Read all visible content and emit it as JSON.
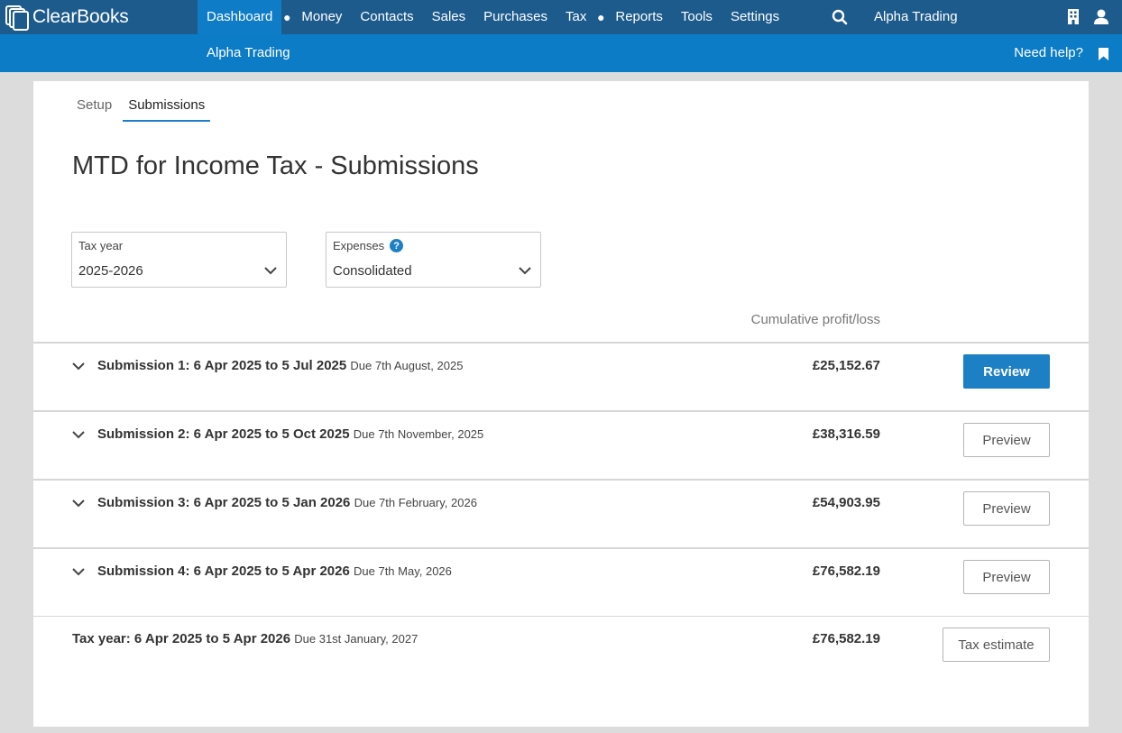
{
  "app": {
    "logo_text": "ClearBooks"
  },
  "nav": {
    "items": [
      {
        "label": "Dashboard",
        "active": true,
        "dot_after": true
      },
      {
        "label": "Money"
      },
      {
        "label": "Contacts"
      },
      {
        "label": "Sales"
      },
      {
        "label": "Purchases"
      },
      {
        "label": "Tax",
        "dot_after": true
      },
      {
        "label": "Reports"
      },
      {
        "label": "Tools"
      },
      {
        "label": "Settings"
      }
    ],
    "org_name": "Alpha Trading"
  },
  "subbar": {
    "title": "Alpha Trading",
    "help_label": "Need help?"
  },
  "tabs": [
    {
      "label": "Setup"
    },
    {
      "label": "Submissions",
      "active": true
    }
  ],
  "page": {
    "title": "MTD for Income Tax - Submissions"
  },
  "filters": {
    "tax_year": {
      "label": "Tax year",
      "value": "2025-2026"
    },
    "expenses": {
      "label": "Expenses",
      "value": "Consolidated",
      "help": "?"
    }
  },
  "table": {
    "column_header": "Cumulative profit/loss",
    "rows": [
      {
        "title": "Submission 1: 6 Apr 2025 to 5 Jul 2025",
        "due": "Due 7th August, 2025",
        "amount": "£25,152.67",
        "action": "Review"
      },
      {
        "title": "Submission 2: 6 Apr 2025 to 5 Oct 2025",
        "due": "Due 7th November, 2025",
        "amount": "£38,316.59",
        "action": "Preview"
      },
      {
        "title": "Submission 3: 6 Apr 2025 to 5 Jan 2026",
        "due": "Due 7th February, 2026",
        "amount": "£54,903.95",
        "action": "Preview"
      },
      {
        "title": "Submission 4: 6 Apr 2025 to 5 Apr 2026",
        "due": "Due 7th May, 2026",
        "amount": "£76,582.19",
        "action": "Preview"
      }
    ],
    "total": {
      "title": "Tax year: 6 Apr 2025 to 5 Apr 2026",
      "due": "Due 31st January, 2027",
      "amount": "£76,582.19",
      "action": "Tax estimate"
    }
  },
  "colors": {
    "nav_bg": "#1d5b8c",
    "subbar_bg": "#0c7cc6",
    "accent": "#1d7fc4"
  }
}
